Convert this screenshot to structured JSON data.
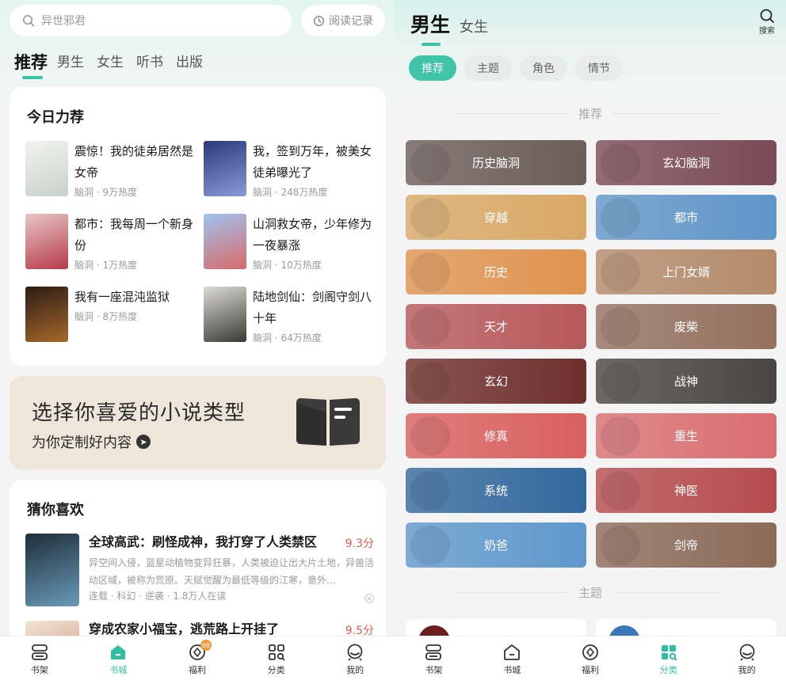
{
  "left": {
    "search": {
      "placeholder": "异世邪君",
      "history": "阅读记录"
    },
    "tabs": [
      "推荐",
      "男生",
      "女生",
      "听书",
      "出版"
    ],
    "today": {
      "title": "今日力荐",
      "books": [
        {
          "title": "震惊！我的徒弟居然是女帝",
          "meta": "脑洞 · 9万热度",
          "cover_colors": [
            "#f2f2ef",
            "#c9d2cc"
          ]
        },
        {
          "title": "我，签到万年，被美女徒弟曝光了",
          "meta": "脑洞 · 248万热度",
          "cover_colors": [
            "#2a3a7a",
            "#8a9ad8"
          ]
        },
        {
          "title": "都市：我每周一个新身份",
          "meta": "脑洞 · 1万热度",
          "cover_colors": [
            "#e8c6c6",
            "#b63a4a"
          ]
        },
        {
          "title": "山洞救女帝，少年修为一夜暴涨",
          "meta": "脑洞 · 10万热度",
          "cover_colors": [
            "#9fc3ef",
            "#d86a6a"
          ]
        },
        {
          "title": "我有一座混沌监狱",
          "meta": "脑洞 · 8万热度",
          "cover_colors": [
            "#2a1c16",
            "#a8682a"
          ]
        },
        {
          "title": "陆地剑仙：剑阁守剑八十年",
          "meta": "脑洞 · 64万热度",
          "cover_colors": [
            "#dcdcd4",
            "#3a3a36"
          ]
        }
      ]
    },
    "banner": {
      "title": "选择你喜爱的小说类型",
      "subtitle": "为你定制好内容"
    },
    "guess": {
      "title": "猜你喜欢",
      "items": [
        {
          "title": "全球高武：刷怪成神，我打穿了人类禁区",
          "score": "9.3分",
          "desc": "异空间入侵，蓝星动植物变异狂暴，人类被迫让出大片土地，异兽活动区域，被称为荒原。天赋觉醒为最低等级的江寒，意外...",
          "tags": "连载 · 科幻 · 逆袭 · 1.8万人在读",
          "cover_colors": [
            "#1e2e3a",
            "#6a9ab8"
          ]
        },
        {
          "title": "穿成农家小福宝，逃荒路上开挂了",
          "score": "9.5分",
          "desc": "",
          "tags": "",
          "cover_colors": [
            "#f2e6d8",
            "#c87a5a"
          ]
        }
      ]
    },
    "nav": [
      {
        "label": "书架",
        "icon": "bookshelf-icon",
        "active": false,
        "badge": ""
      },
      {
        "label": "书城",
        "icon": "home-icon",
        "active": true,
        "badge": ""
      },
      {
        "label": "福利",
        "icon": "welfare-icon",
        "active": false,
        "badge": "68"
      },
      {
        "label": "分类",
        "icon": "category-icon",
        "active": false,
        "badge": ""
      },
      {
        "label": "我的",
        "icon": "profile-icon",
        "active": false,
        "badge": ""
      }
    ]
  },
  "right": {
    "gender_active": "男生",
    "gender_other": "女生",
    "search_label": "搜索",
    "pills": [
      "推荐",
      "主题",
      "角色",
      "情节"
    ],
    "section_recommend": "推荐",
    "section_theme": "主题",
    "tiles": [
      {
        "label": "历史脑洞",
        "color": "#6b5d58"
      },
      {
        "label": "玄幻脑洞",
        "color": "#7a4a55"
      },
      {
        "label": "穿越",
        "color": "#d9a866"
      },
      {
        "label": "都市",
        "color": "#5f95c8"
      },
      {
        "label": "历史",
        "color": "#e0934f"
      },
      {
        "label": "上门女婿",
        "color": "#b48a6a"
      },
      {
        "label": "天才",
        "color": "#b7585a"
      },
      {
        "label": "废柴",
        "color": "#94705e"
      },
      {
        "label": "玄幻",
        "color": "#6f2f2c"
      },
      {
        "label": "战神",
        "color": "#4a4542"
      },
      {
        "label": "修真",
        "color": "#d9605e"
      },
      {
        "label": "重生",
        "color": "#d96e72"
      },
      {
        "label": "系统",
        "color": "#32689c"
      },
      {
        "label": "神医",
        "color": "#b64b4e"
      },
      {
        "label": "奶爸",
        "color": "#5f98cc"
      },
      {
        "label": "剑帝",
        "color": "#8c6a58"
      }
    ],
    "nav": [
      {
        "label": "书架",
        "icon": "bookshelf-icon",
        "active": false
      },
      {
        "label": "书城",
        "icon": "home-icon",
        "active": false
      },
      {
        "label": "福利",
        "icon": "welfare-icon",
        "active": false
      },
      {
        "label": "分类",
        "icon": "category-icon",
        "active": true
      },
      {
        "label": "我的",
        "icon": "profile-icon",
        "active": false
      }
    ]
  }
}
